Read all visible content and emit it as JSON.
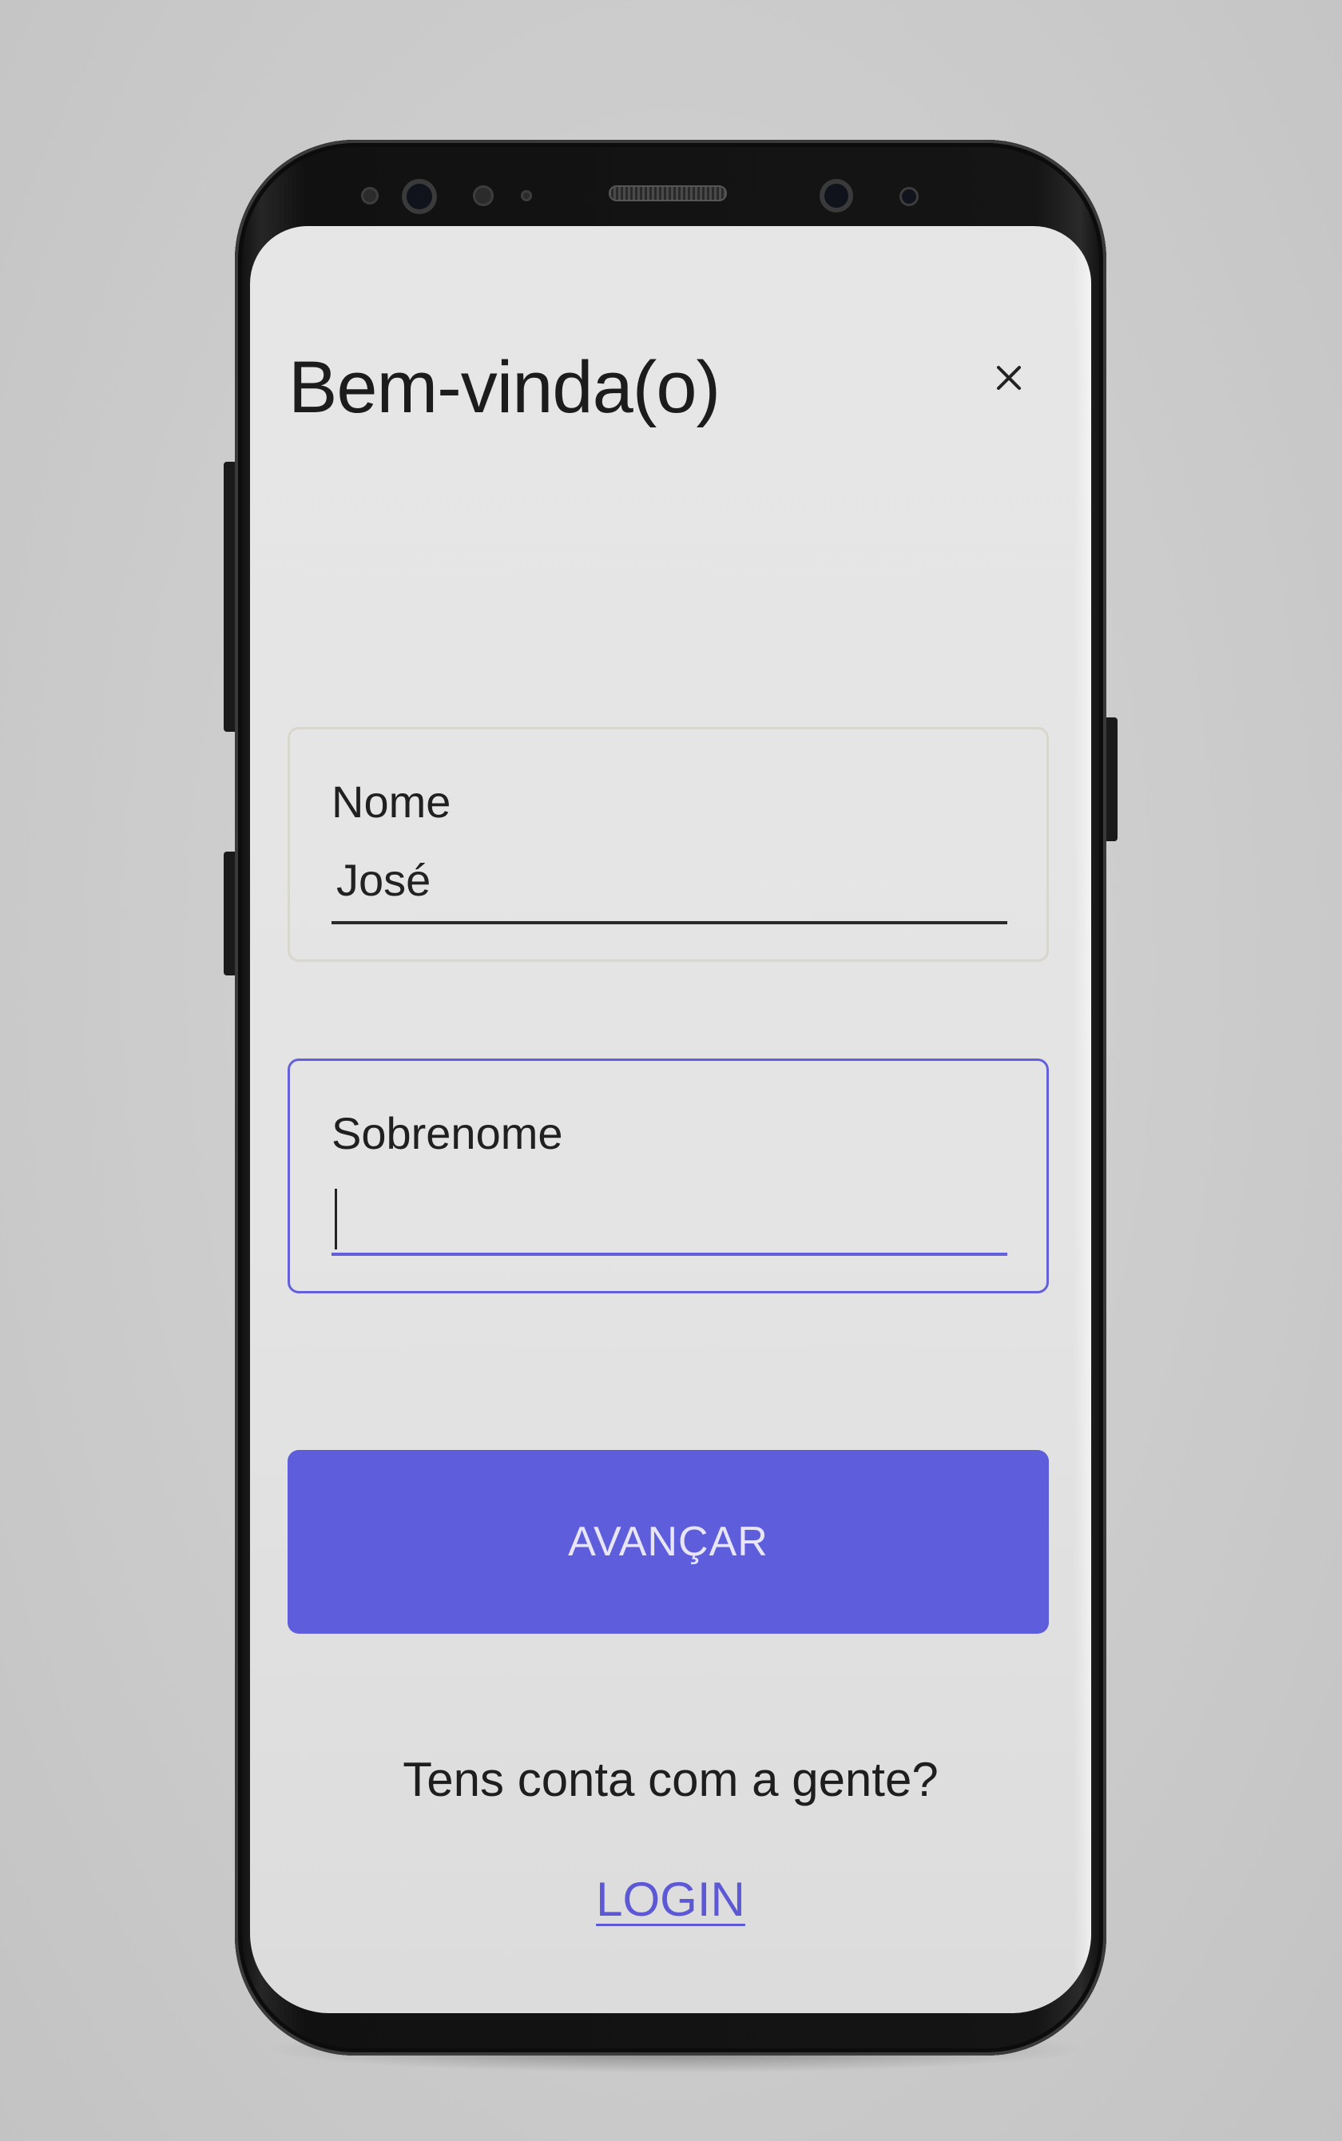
{
  "screen": {
    "title": "Bem-vinda(o)",
    "close_icon": "close-icon"
  },
  "form": {
    "name_label": "Nome",
    "name_value": "José",
    "surname_label": "Sobrenome",
    "surname_value": "",
    "submit_label": "AVANÇAR"
  },
  "footer": {
    "prompt": "Tens conta com a gente?",
    "login_label": "LOGIN"
  },
  "colors": {
    "accent": "#5e5edd",
    "focus_border": "#6460dc",
    "link": "#5c58d6"
  }
}
